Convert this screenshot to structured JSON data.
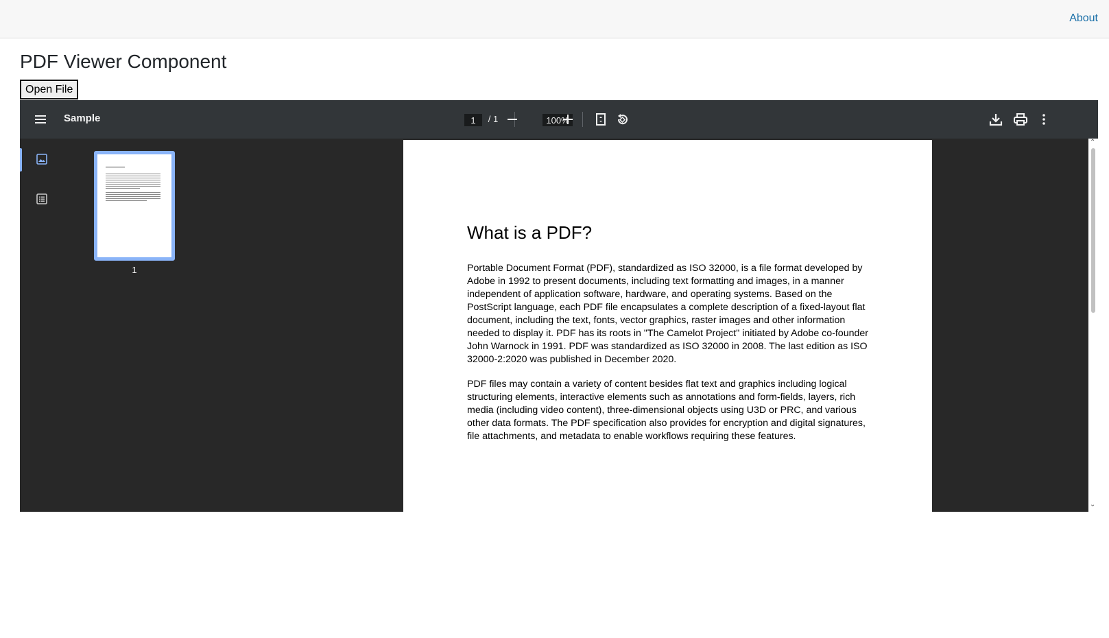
{
  "nav": {
    "about_link": "About"
  },
  "header": {
    "title": "PDF Viewer Component",
    "open_button": "Open File"
  },
  "viewer": {
    "doc_title": "Sample",
    "current_page": "1",
    "page_total": "/ 1",
    "zoom": "100%",
    "thumbnail_label": "1",
    "icons": {
      "menu": "menu-icon",
      "zoom_out": "minus-icon",
      "zoom_in": "plus-icon",
      "fit": "fit-page-icon",
      "rotate": "rotate-icon",
      "download": "download-icon",
      "print": "print-icon",
      "more": "more-vertical-icon",
      "thumbnails": "image-icon",
      "outline": "list-icon"
    },
    "colors": {
      "toolbar": "#323639",
      "background": "#282828",
      "accent": "#8ab4f8"
    }
  },
  "document": {
    "heading": "What is a PDF?",
    "paragraph1": "Portable Document Format (PDF), standardized as ISO 32000, is a file format developed by Adobe in 1992 to present documents, including text formatting and images, in a manner independent of application software, hardware, and operating systems. Based on the PostScript language, each PDF file encapsulates a complete description of a fixed-layout flat document, including the text, fonts, vector graphics, raster images and other information needed to display it. PDF has its roots in \"The Camelot Project\" initiated by Adobe co-founder John Warnock in 1991. PDF was standardized as ISO 32000 in 2008. The last edition as ISO 32000-2:2020 was published in December 2020.",
    "paragraph2": "PDF files may contain a variety of content besides flat text and graphics including logical structuring elements, interactive elements such as annotations and form-fields, layers, rich media (including video content), three-dimensional objects using U3D or PRC, and various other data formats. The PDF specification also provides for encryption and digital signatures, file attachments, and metadata to enable workflows requiring these features."
  }
}
